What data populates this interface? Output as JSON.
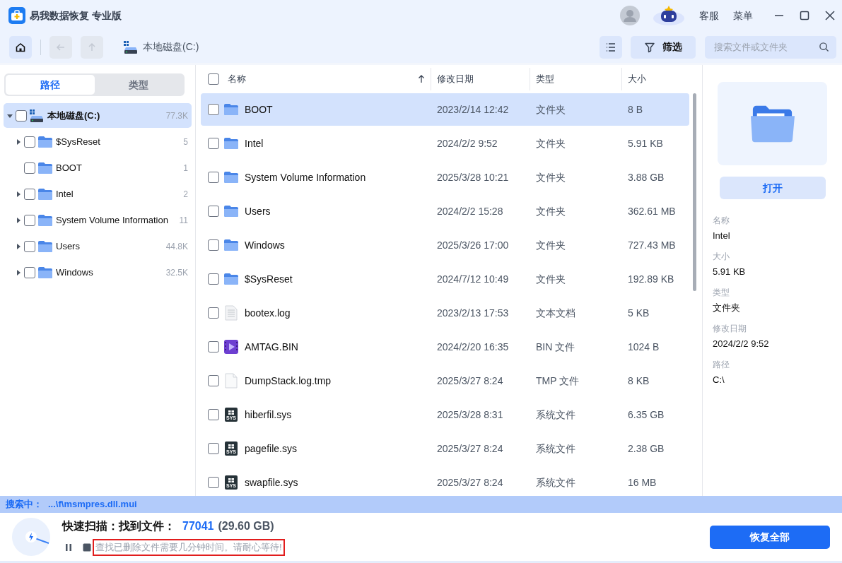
{
  "window": {
    "title": "易我数据恢复 专业版",
    "header_links": [
      "客服",
      "菜单"
    ]
  },
  "toolbar": {
    "location": "本地磁盘(C:)",
    "filter_button": "筛选",
    "search": {
      "placeholder": "搜索文件或文件夹"
    }
  },
  "sidebar": {
    "tabs": [
      {
        "label": "路径",
        "selected": true
      },
      {
        "label": "类型",
        "selected": false
      }
    ],
    "tree": [
      {
        "label": "本地磁盘(C:)",
        "count": "77.3K",
        "kind": "drive",
        "expanded": true,
        "checked": false,
        "selected": true,
        "children": [
          {
            "label": "$SysReset",
            "count": "5",
            "kind": "folder",
            "expanded": false,
            "checked": false,
            "selected": false
          },
          {
            "label": "BOOT",
            "count": "1",
            "kind": "empty_folder",
            "checked": false,
            "selected": false
          },
          {
            "label": "Intel",
            "count": "2",
            "kind": "folder",
            "expanded": false,
            "checked": false,
            "selected": false
          },
          {
            "label": "System Volume Information",
            "count": "11",
            "kind": "folder",
            "expanded": false,
            "checked": false,
            "selected": false
          },
          {
            "label": "Users",
            "count": "44.8K",
            "kind": "folder",
            "expanded": false,
            "checked": false,
            "selected": false
          },
          {
            "label": "Windows",
            "count": "32.5K",
            "kind": "folder",
            "expanded": false,
            "checked": false,
            "selected": false
          }
        ]
      }
    ]
  },
  "table": {
    "columns": [
      "名称",
      "修改日期",
      "类型",
      "大小"
    ],
    "select_all_checked": false,
    "rows": [
      {
        "name": "BOOT",
        "date": "2023/2/14 12:42",
        "type": "文件夹",
        "size": "8 B",
        "kind": "folder",
        "checked": false,
        "selected": true
      },
      {
        "name": "Intel",
        "date": "2024/2/2 9:52",
        "type": "文件夹",
        "size": "5.91 KB",
        "kind": "folder",
        "checked": false,
        "selected": false
      },
      {
        "name": "System Volume Information",
        "date": "2025/3/28 10:21",
        "type": "文件夹",
        "size": "3.88 GB",
        "kind": "folder",
        "checked": false,
        "selected": false
      },
      {
        "name": "Users",
        "date": "2024/2/2 15:28",
        "type": "文件夹",
        "size": "362.61 MB",
        "kind": "folder",
        "checked": false,
        "selected": false
      },
      {
        "name": "Windows",
        "date": "2025/3/26 17:00",
        "type": "文件夹",
        "size": "727.43 MB",
        "kind": "folder",
        "checked": false,
        "selected": false
      },
      {
        "name": "$SysReset",
        "date": "2024/7/12 10:49",
        "type": "文件夹",
        "size": "192.89 KB",
        "kind": "folder",
        "checked": false,
        "selected": false
      },
      {
        "name": "bootex.log",
        "date": "2023/2/13 17:53",
        "type": "文本文档",
        "size": "5 KB",
        "kind": "text",
        "checked": false,
        "selected": false
      },
      {
        "name": "AMTAG.BIN",
        "date": "2024/2/20 16:35",
        "type": "BIN 文件",
        "size": "1024 B",
        "kind": "video",
        "checked": false,
        "selected": false
      },
      {
        "name": "DumpStack.log.tmp",
        "date": "2025/3/27 8:24",
        "type": "TMP 文件",
        "size": "8 KB",
        "kind": "blank",
        "checked": false,
        "selected": false
      },
      {
        "name": "hiberfil.sys",
        "date": "2025/3/28 8:31",
        "type": "系统文件",
        "size": "6.35 GB",
        "kind": "system",
        "icon_label": "SYS",
        "checked": false,
        "selected": false
      },
      {
        "name": "pagefile.sys",
        "date": "2025/3/27 8:24",
        "type": "系统文件",
        "size": "2.38 GB",
        "kind": "system",
        "icon_label": "SYS",
        "checked": false,
        "selected": false
      },
      {
        "name": "swapfile.sys",
        "date": "2025/3/27 8:24",
        "type": "系统文件",
        "size": "16 MB",
        "kind": "system",
        "icon_label": "SYS",
        "checked": false,
        "selected": false
      }
    ]
  },
  "details": {
    "open_button": "打开",
    "fields": [
      {
        "label": "名称",
        "value": "Intel"
      },
      {
        "label": "大小",
        "value": "5.91 KB"
      },
      {
        "label": "类型",
        "value": "文件夹"
      },
      {
        "label": "修改日期",
        "value": "2024/2/2 9:52"
      },
      {
        "label": "路径",
        "value": "C:\\"
      }
    ]
  },
  "status_bar": {
    "label": "搜索中：",
    "path": "...\\f\\msmpres.dll.mui"
  },
  "scan": {
    "title": "快速扫描：找到文件：",
    "count": "77041",
    "size": "(29.60 GB)",
    "message": "查找已删除文件需要几分钟时间。请耐心等待!",
    "recover_button": "恢复全部"
  }
}
